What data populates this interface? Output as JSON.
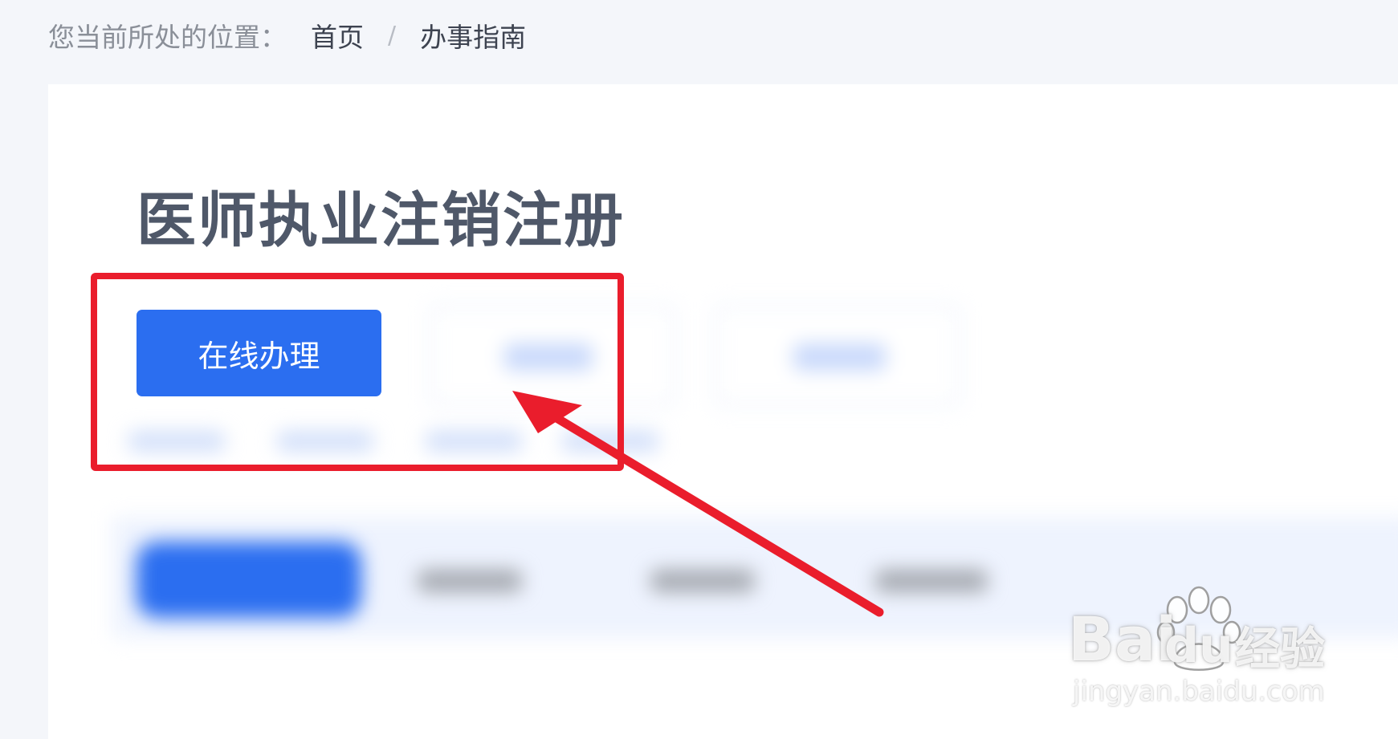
{
  "breadcrumb": {
    "prefix": "您当前所处的位置：",
    "home": "首页",
    "separator": "/",
    "current": "办事指南"
  },
  "page": {
    "title": "医师执业注销注册"
  },
  "actions": {
    "online_button": "在线办理"
  },
  "watermark": {
    "brand": "Bai",
    "brand_du": "du",
    "suffix": "经验",
    "url": "jingyan.baidu.com"
  },
  "colors": {
    "accent": "#2b6ef0",
    "annotation_red": "#ea1d2c",
    "title": "#4f5869",
    "page_bg": "#f4f6fa"
  },
  "icons": {
    "annotation_arrow": "arrow-up-left-icon",
    "watermark_logo": "paw-icon"
  }
}
